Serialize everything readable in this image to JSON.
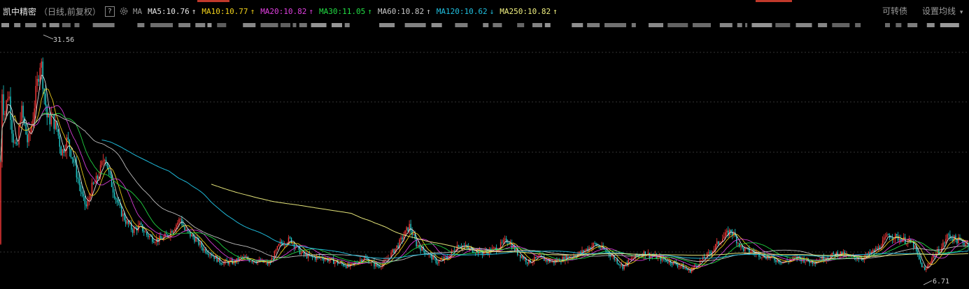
{
  "header": {
    "stock_name": "凯中精密",
    "period": "（日线,前复权）",
    "help": "?",
    "ma_label": "MA",
    "convertible": "可转债",
    "ma_settings": "设置均线",
    "ma_settings_caret": "▾"
  },
  "colors": {
    "up": "#ff3b3b",
    "down": "#20d0d0",
    "ma5": "#e8e8e8",
    "ma10": "#f2d21b",
    "ma20": "#e040e0",
    "ma30": "#22dd44",
    "ma60": "#c8c8c8",
    "ma120": "#20c0e0",
    "ma250": "#f0f080"
  },
  "chart_data": {
    "type": "candlestick",
    "price_range": [
      5.5,
      33.5
    ],
    "high_label": "31.56",
    "low_label": "6.71",
    "grid": "horizontal dashed",
    "trend_anchors": [
      [
        0,
        10.0
      ],
      [
        2,
        28.0
      ],
      [
        6,
        24.0
      ],
      [
        12,
        27.0
      ],
      [
        18,
        22.0
      ],
      [
        24,
        20.0
      ],
      [
        30,
        25.0
      ],
      [
        40,
        21.0
      ],
      [
        46,
        23.5
      ],
      [
        52,
        27.0
      ],
      [
        58,
        30.5
      ],
      [
        62,
        27.5
      ],
      [
        68,
        23.5
      ],
      [
        74,
        24.0
      ],
      [
        82,
        22.5
      ],
      [
        88,
        20.0
      ],
      [
        96,
        21.5
      ],
      [
        104,
        19.5
      ],
      [
        112,
        17.0
      ],
      [
        118,
        15.0
      ],
      [
        124,
        14.0
      ],
      [
        130,
        16.0
      ],
      [
        138,
        17.0
      ],
      [
        145,
        18.5
      ],
      [
        150,
        20.0
      ],
      [
        156,
        17.5
      ],
      [
        162,
        16.0
      ],
      [
        170,
        14.0
      ],
      [
        180,
        12.5
      ],
      [
        190,
        11.5
      ],
      [
        200,
        12.0
      ],
      [
        210,
        11.0
      ],
      [
        220,
        10.5
      ],
      [
        230,
        10.5
      ],
      [
        240,
        11.0
      ],
      [
        250,
        12.0
      ],
      [
        258,
        12.8
      ],
      [
        264,
        11.5
      ],
      [
        272,
        11.0
      ],
      [
        280,
        10.5
      ],
      [
        290,
        9.5
      ],
      [
        300,
        9.0
      ],
      [
        315,
        8.0
      ],
      [
        335,
        8.0
      ],
      [
        345,
        8.5
      ],
      [
        360,
        8.2
      ],
      [
        375,
        8.0
      ],
      [
        385,
        7.8
      ],
      [
        400,
        10.0
      ],
      [
        415,
        10.5
      ],
      [
        430,
        9.0
      ],
      [
        445,
        8.5
      ],
      [
        460,
        8.5
      ],
      [
        480,
        8.0
      ],
      [
        500,
        7.5
      ],
      [
        520,
        8.5
      ],
      [
        540,
        7.5
      ],
      [
        550,
        8.0
      ],
      [
        560,
        9.0
      ],
      [
        570,
        10.0
      ],
      [
        585,
        12.0
      ],
      [
        595,
        10.0
      ],
      [
        610,
        9.0
      ],
      [
        625,
        8.0
      ],
      [
        640,
        8.5
      ],
      [
        655,
        10.0
      ],
      [
        670,
        9.5
      ],
      [
        690,
        9.0
      ],
      [
        710,
        9.5
      ],
      [
        725,
        10.5
      ],
      [
        740,
        9.0
      ],
      [
        755,
        8.0
      ],
      [
        770,
        8.5
      ],
      [
        790,
        8.0
      ],
      [
        810,
        8.5
      ],
      [
        830,
        9.0
      ],
      [
        850,
        10.0
      ],
      [
        870,
        9.0
      ],
      [
        890,
        7.5
      ],
      [
        905,
        8.5
      ],
      [
        920,
        9.0
      ],
      [
        940,
        8.5
      ],
      [
        960,
        8.0
      ],
      [
        975,
        7.5
      ],
      [
        985,
        7.0
      ],
      [
        1000,
        8.0
      ],
      [
        1015,
        9.0
      ],
      [
        1030,
        10.5
      ],
      [
        1045,
        11.5
      ],
      [
        1060,
        9.5
      ],
      [
        1080,
        9.0
      ],
      [
        1100,
        8.5
      ],
      [
        1120,
        8.0
      ],
      [
        1140,
        8.5
      ],
      [
        1160,
        8.0
      ],
      [
        1180,
        8.5
      ],
      [
        1200,
        9.0
      ],
      [
        1215,
        8.5
      ],
      [
        1235,
        8.5
      ],
      [
        1255,
        9.5
      ],
      [
        1270,
        11.0
      ],
      [
        1290,
        10.5
      ],
      [
        1305,
        10.0
      ],
      [
        1315,
        8.0
      ],
      [
        1322,
        7.0
      ],
      [
        1332,
        8.5
      ],
      [
        1345,
        9.5
      ],
      [
        1355,
        11.0
      ],
      [
        1365,
        10.5
      ],
      [
        1385,
        10.0
      ]
    ],
    "series": [
      {
        "name": "MA5",
        "value": "10.76",
        "arrow": "↑",
        "color_key": "ma5",
        "window": 5
      },
      {
        "name": "MA10",
        "value": "10.77",
        "arrow": "↑",
        "color_key": "ma10",
        "window": 10
      },
      {
        "name": "MA20",
        "value": "10.82",
        "arrow": "↑",
        "color_key": "ma20",
        "window": 20
      },
      {
        "name": "MA30",
        "value": "11.05",
        "arrow": "↑",
        "color_key": "ma30",
        "window": 30
      },
      {
        "name": "MA60",
        "value": "10.82",
        "arrow": "↑",
        "color_key": "ma60",
        "window": 60
      },
      {
        "name": "MA120",
        "value": "10.62",
        "arrow": "↓",
        "color_key": "ma120",
        "window": 120
      },
      {
        "name": "MA250",
        "value": "10.82",
        "arrow": "↑",
        "color_key": "ma250",
        "window": 250
      }
    ]
  }
}
